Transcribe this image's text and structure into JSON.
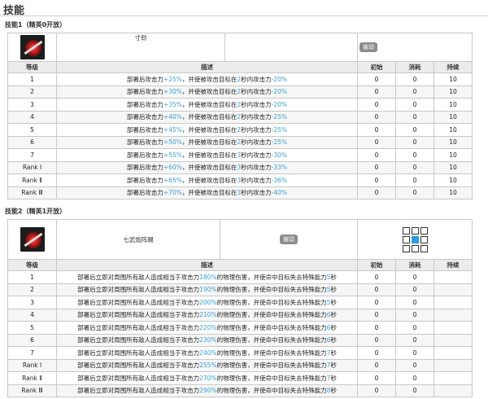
{
  "page_title": "技能",
  "skills": [
    {
      "header": "技能1（精英0开放）",
      "name": "寸劲",
      "type_badge": "被动",
      "icon": "red-burst-skill-icon",
      "columns": [
        "等级",
        "描述",
        "初始",
        "消耗",
        "持续"
      ],
      "rows": [
        {
          "level": "1",
          "d1": "部署后攻击力",
          "n1": "+25%",
          "d2": "，并使被攻击目标在",
          "n2": "2",
          "d3": "秒内攻击力",
          "n3": "-20%",
          "d4": "",
          "init": "0",
          "cost": "0",
          "dur": "10"
        },
        {
          "level": "2",
          "d1": "部署后攻击力",
          "n1": "+30%",
          "d2": "，并使被攻击目标在",
          "n2": "2",
          "d3": "秒内攻击力",
          "n3": "-20%",
          "d4": "",
          "init": "0",
          "cost": "0",
          "dur": "10"
        },
        {
          "level": "3",
          "d1": "部署后攻击力",
          "n1": "+35%",
          "d2": "，并使被攻击目标在",
          "n2": "2",
          "d3": "秒内攻击力",
          "n3": "-20%",
          "d4": "",
          "init": "0",
          "cost": "0",
          "dur": "10"
        },
        {
          "level": "4",
          "d1": "部署后攻击力",
          "n1": "+40%",
          "d2": "，并使被攻击目标在",
          "n2": "2",
          "d3": "秒内攻击力",
          "n3": "-25%",
          "d4": "",
          "init": "0",
          "cost": "0",
          "dur": "10"
        },
        {
          "level": "5",
          "d1": "部署后攻击力",
          "n1": "+45%",
          "d2": "，并使被攻击目标在",
          "n2": "2",
          "d3": "秒内攻击力",
          "n3": "-25%",
          "d4": "",
          "init": "0",
          "cost": "0",
          "dur": "10"
        },
        {
          "level": "6",
          "d1": "部署后攻击力",
          "n1": "+50%",
          "d2": "，并使被攻击目标在",
          "n2": "2",
          "d3": "秒内攻击力",
          "n3": "-25%",
          "d4": "",
          "init": "0",
          "cost": "0",
          "dur": "10"
        },
        {
          "level": "7",
          "d1": "部署后攻击力",
          "n1": "+55%",
          "d2": "，并使被攻击目标在",
          "n2": "3",
          "d3": "秒内攻击力",
          "n3": "-30%",
          "d4": "",
          "init": "0",
          "cost": "0",
          "dur": "10"
        },
        {
          "level": "Rank Ⅰ",
          "d1": "部署后攻击力",
          "n1": "+60%",
          "d2": "，并使被攻击目标在",
          "n2": "3",
          "d3": "秒内攻击力",
          "n3": "-33%",
          "d4": "",
          "init": "0",
          "cost": "0",
          "dur": "10"
        },
        {
          "level": "Rank Ⅱ",
          "d1": "部署后攻击力",
          "n1": "+65%",
          "d2": "，并使被攻击目标在",
          "n2": "3",
          "d3": "秒内攻击力",
          "n3": "-36%",
          "d4": "",
          "init": "0",
          "cost": "0",
          "dur": "10"
        },
        {
          "level": "Rank Ⅲ",
          "d1": "部署后攻击力",
          "n1": "+70%",
          "d2": "，并使被攻击目标在",
          "n2": "3",
          "d3": "秒内攻击力",
          "n3": "-40%",
          "d4": "",
          "init": "0",
          "cost": "0",
          "dur": "10"
        }
      ]
    },
    {
      "header": "技能2（精英1开放）",
      "name": "七武炮阵踢",
      "type_badge": "被动",
      "icon": "red-kick-skill-icon",
      "range_pattern": [
        0,
        0,
        0,
        0,
        1,
        0,
        0,
        0,
        0
      ],
      "columns": [
        "等级",
        "描述",
        "初始",
        "消耗",
        "持续"
      ],
      "rows": [
        {
          "level": "1",
          "d1": "部署后立即对周围所有敌人造成相当于攻击力",
          "n1": "180%",
          "d2": "的物理伤害，并使命中目标失去特殊能力",
          "n2": "5",
          "d3": "秒",
          "n3": "",
          "d4": "",
          "init": "0",
          "cost": "0",
          "dur": ""
        },
        {
          "level": "2",
          "d1": "部署后立即对周围所有敌人造成相当于攻击力",
          "n1": "190%",
          "d2": "的物理伤害，并使命中目标失去特殊能力",
          "n2": "5",
          "d3": "秒",
          "n3": "",
          "d4": "",
          "init": "0",
          "cost": "0",
          "dur": ""
        },
        {
          "level": "3",
          "d1": "部署后立即对周围所有敌人造成相当于攻击力",
          "n1": "200%",
          "d2": "的物理伤害，并使命中目标失去特殊能力",
          "n2": "5",
          "d3": "秒",
          "n3": "",
          "d4": "",
          "init": "0",
          "cost": "0",
          "dur": ""
        },
        {
          "level": "4",
          "d1": "部署后立即对周围所有敌人造成相当于攻击力",
          "n1": "210%",
          "d2": "的物理伤害，并使命中目标失去特殊能力",
          "n2": "6",
          "d3": "秒",
          "n3": "",
          "d4": "",
          "init": "0",
          "cost": "0",
          "dur": ""
        },
        {
          "level": "5",
          "d1": "部署后立即对周围所有敌人造成相当于攻击力",
          "n1": "220%",
          "d2": "的物理伤害，并使命中目标失去特殊能力",
          "n2": "6",
          "d3": "秒",
          "n3": "",
          "d4": "",
          "init": "0",
          "cost": "0",
          "dur": ""
        },
        {
          "level": "6",
          "d1": "部署后立即对周围所有敌人造成相当于攻击力",
          "n1": "230%",
          "d2": "的物理伤害，并使命中目标失去特殊能力",
          "n2": "6",
          "d3": "秒",
          "n3": "",
          "d4": "",
          "init": "0",
          "cost": "0",
          "dur": ""
        },
        {
          "level": "7",
          "d1": "部署后立即对周围所有敌人造成相当于攻击力",
          "n1": "240%",
          "d2": "的物理伤害，并使命中目标失去特殊能力",
          "n2": "7",
          "d3": "秒",
          "n3": "",
          "d4": "",
          "init": "0",
          "cost": "0",
          "dur": ""
        },
        {
          "level": "Rank Ⅰ",
          "d1": "部署后立即对周围所有敌人造成相当于攻击力",
          "n1": "255%",
          "d2": "的物理伤害，并使命中目标失去特殊能力",
          "n2": "7",
          "d3": "秒",
          "n3": "",
          "d4": "",
          "init": "0",
          "cost": "0",
          "dur": ""
        },
        {
          "level": "Rank Ⅱ",
          "d1": "部署后立即对周围所有敌人造成相当于攻击力",
          "n1": "270%",
          "d2": "的物理伤害，并使命中目标失去特殊能力",
          "n2": "7",
          "d3": "秒",
          "n3": "",
          "d4": "",
          "init": "0",
          "cost": "0",
          "dur": ""
        },
        {
          "level": "Rank Ⅲ",
          "d1": "部署后立即对周围所有敌人造成相当于攻击力",
          "n1": "290%",
          "d2": "的物理伤害，并使命中目标失去特殊能力",
          "n2": "8",
          "d3": "秒",
          "n3": "",
          "d4": "",
          "init": "0",
          "cost": "0",
          "dur": ""
        }
      ]
    }
  ]
}
